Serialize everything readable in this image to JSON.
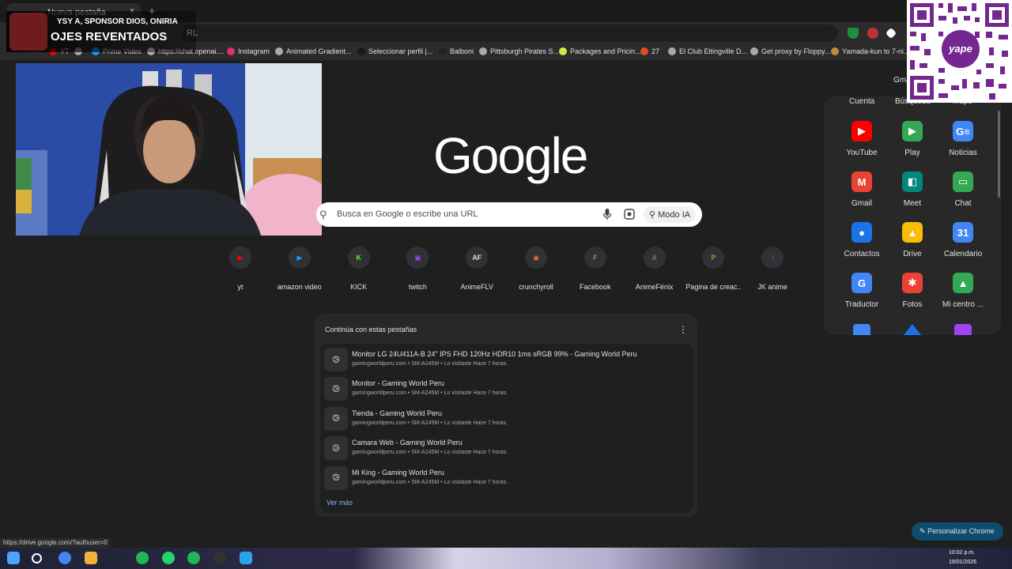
{
  "tab": {
    "title": "Nueva pestaña",
    "close": "×",
    "new_tab": "+"
  },
  "omnibox": {
    "value": "Busca en Google o escribe una URL",
    "visible_fragment": "RL"
  },
  "bookmarks": [
    {
      "label": "YT",
      "color": "#ff0000"
    },
    {
      "label": "",
      "color": "#aaaaaa"
    },
    {
      "label": "Prime Video",
      "color": "#1a98ff"
    },
    {
      "label": "https://chat.openai....",
      "color": "#aaaaaa"
    },
    {
      "label": "Instagram",
      "color": "#e1306c"
    },
    {
      "label": "Animated Gradient...",
      "color": "#aaaaaa"
    },
    {
      "label": "Seleccionar perfil |...",
      "color": "#1a1a1a"
    },
    {
      "label": "Balboni",
      "color": "#222222"
    },
    {
      "label": "Pittsburgh Pirates S...",
      "color": "#aaaaaa"
    },
    {
      "label": "Packages and Pricin...",
      "color": "#d6e64a"
    },
    {
      "label": "27",
      "color": "#e34d1c"
    },
    {
      "label": "El Club Eltingville D...",
      "color": "#aaaaaa"
    },
    {
      "label": "Get proxy by Floppy...",
      "color": "#aaaaaa"
    },
    {
      "label": "Yamada-kun to 7-ni...",
      "color": "#c18c3a"
    }
  ],
  "stream": {
    "line1": "YSY A, SPONSOR DIOS, ONIRIA",
    "line2": "OJES REVENTADOS"
  },
  "header": {
    "gmail": "Gmail"
  },
  "logo": "Google",
  "search": {
    "placeholder": "Busca en Google o escribe una URL",
    "ai_mode": "Modo IA"
  },
  "shortcuts": [
    {
      "label": "yt",
      "glyph": "▶",
      "color": "#ff0000"
    },
    {
      "label": "amazon video",
      "glyph": "▶",
      "color": "#1a98ff"
    },
    {
      "label": "KICK",
      "glyph": "K",
      "color": "#53fc18"
    },
    {
      "label": "twitch",
      "glyph": "▣",
      "color": "#9146ff"
    },
    {
      "label": "AnimeFLV",
      "glyph": "AF",
      "color": "#dddddd"
    },
    {
      "label": "crunchyroll",
      "glyph": "◉",
      "color": "#f47521"
    },
    {
      "label": "Facebook",
      "glyph": "F",
      "color": "#5ea35e"
    },
    {
      "label": "AnimeFénix",
      "glyph": "A",
      "color": "#a06a5a"
    },
    {
      "label": "Pagina de creac...",
      "glyph": "P",
      "color": "#7aa53a"
    },
    {
      "label": "JK anime",
      "glyph": "J",
      "color": "#3a4a6e"
    }
  ],
  "continue_panel": {
    "title": "Continúa con estas pestañas",
    "more": "Ver más",
    "rows": [
      {
        "title": "Monitor LG 24U411A-B 24\" IPS FHD 120Hz HDR10 1ms sRGB 99% - Gaming World Peru",
        "sub": "gamingworldperu.com • SM-A245M • Lo visitaste Hace 7 horas."
      },
      {
        "title": "Monitor - Gaming World Peru",
        "sub": "gamingworldperu.com • SM-A245M • Lo visitaste Hace 7 horas."
      },
      {
        "title": "Tienda - Gaming World Peru",
        "sub": "gamingworldperu.com • SM-A245M • Lo visitaste Hace 7 horas."
      },
      {
        "title": "Camara Web - Gaming World Peru",
        "sub": "gamingworldperu.com • SM-A245M • Lo visitaste Hace 7 horas."
      },
      {
        "title": "Mi King - Gaming World Peru",
        "sub": "gamingworldperu.com • SM-A245M • Lo visitaste Hace 7 horas."
      }
    ]
  },
  "apps_panel": {
    "headers": [
      "Cuenta",
      "Búsqueda",
      "Maps"
    ],
    "apps": [
      {
        "label": "YouTube",
        "glyph": "▶",
        "color": "#ff0000"
      },
      {
        "label": "Play",
        "glyph": "▶",
        "color": "#34a853"
      },
      {
        "label": "Noticias",
        "glyph": "G≡",
        "color": "#4285f4"
      },
      {
        "label": "Gmail",
        "glyph": "M",
        "color": "#ea4335"
      },
      {
        "label": "Meet",
        "glyph": "◧",
        "color": "#00897b"
      },
      {
        "label": "Chat",
        "glyph": "▭",
        "color": "#34a853"
      },
      {
        "label": "Contactos",
        "glyph": "●",
        "color": "#1a73e8"
      },
      {
        "label": "Drive",
        "glyph": "▲",
        "color": "#fbbc04"
      },
      {
        "label": "Calendario",
        "glyph": "31",
        "color": "#4285f4"
      },
      {
        "label": "Traductor",
        "glyph": "G",
        "color": "#4285f4"
      },
      {
        "label": "Fotos",
        "glyph": "✱",
        "color": "#ea4335"
      },
      {
        "label": "Mi centro ...",
        "glyph": "▲",
        "color": "#34a853"
      }
    ]
  },
  "qr": {
    "brand": "yape"
  },
  "personalize": "Personalizar Chrome",
  "status_url": "https://drive.google.com/?authuser=0",
  "taskbar": {
    "time": "10:02 p.m.",
    "date": "19/01/2026"
  },
  "colors": {
    "background": "#1f1f1f",
    "panel": "#282828",
    "link": "#8ab4f8"
  }
}
